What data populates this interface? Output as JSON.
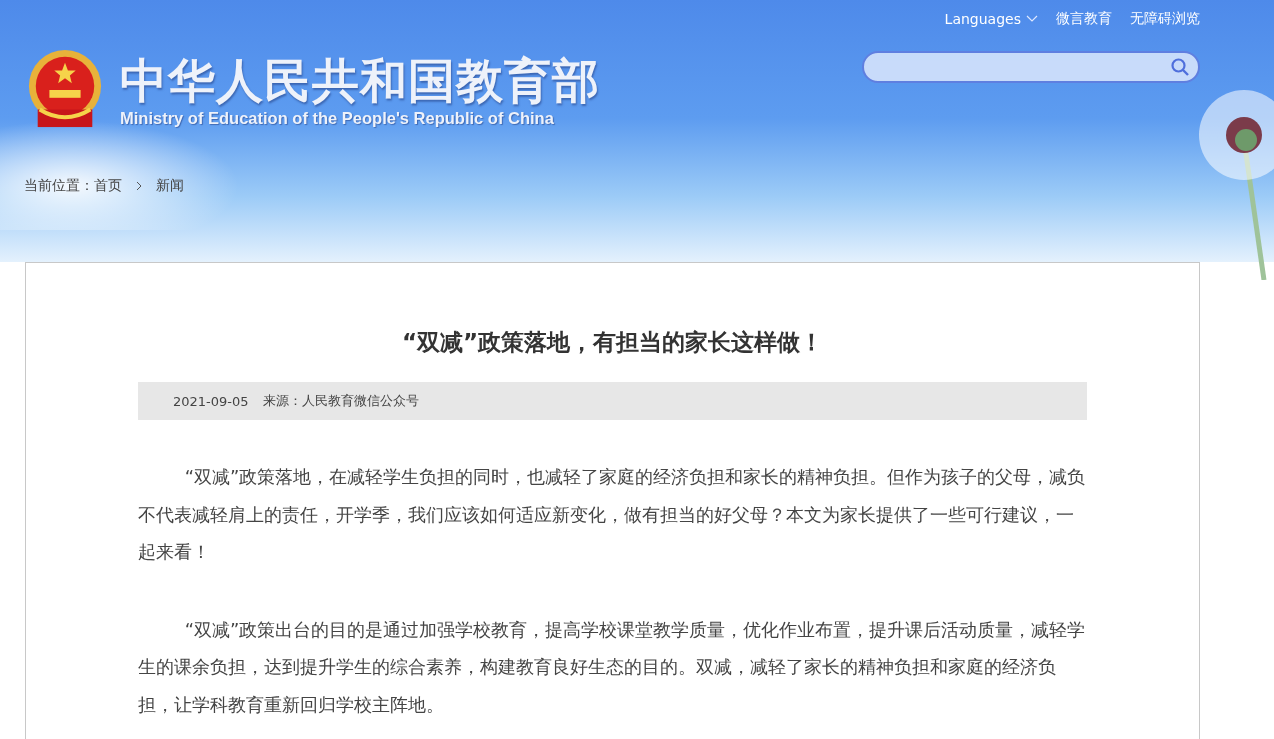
{
  "top_links": [
    {
      "label": "Languages",
      "kind": "dropdown"
    },
    {
      "label": "微言教育",
      "kind": "link"
    },
    {
      "label": "无障碍浏览",
      "kind": "link"
    }
  ],
  "site": {
    "title": "中华人民共和国教育部",
    "subtitle": "Ministry of Education of the People's Republic of China"
  },
  "breadcrumb": {
    "label": "当前位置：",
    "items": [
      "首页",
      "新闻"
    ]
  },
  "article": {
    "title": "“双减”政策落地，有担当的家长这样做！",
    "date": "2021-09-05",
    "source": "来源：人民教育微信公众号",
    "paragraphs": [
      "“双减”政策落地，在减轻学生负担的同时，也减轻了家庭的经济负担和家长的精神负担。但作为孩子的父母，减负不代表减轻肩上的责任，开学季，我们应该如何适应新变化，做有担当的好父母？本文为家长提供了一些可行建议，一起来看！",
      "“双减”政策出台的目的是通过加强学校教育，提高学校课堂教学质量，优化作业布置，提升课后活动质量，减轻学生的课余负担，达到提升学生的综合素养，构建教育良好生态的目的。双减，减轻了家长的精神负担和家庭的经济负担，让学科教育重新回归学校主阵地。"
    ]
  }
}
